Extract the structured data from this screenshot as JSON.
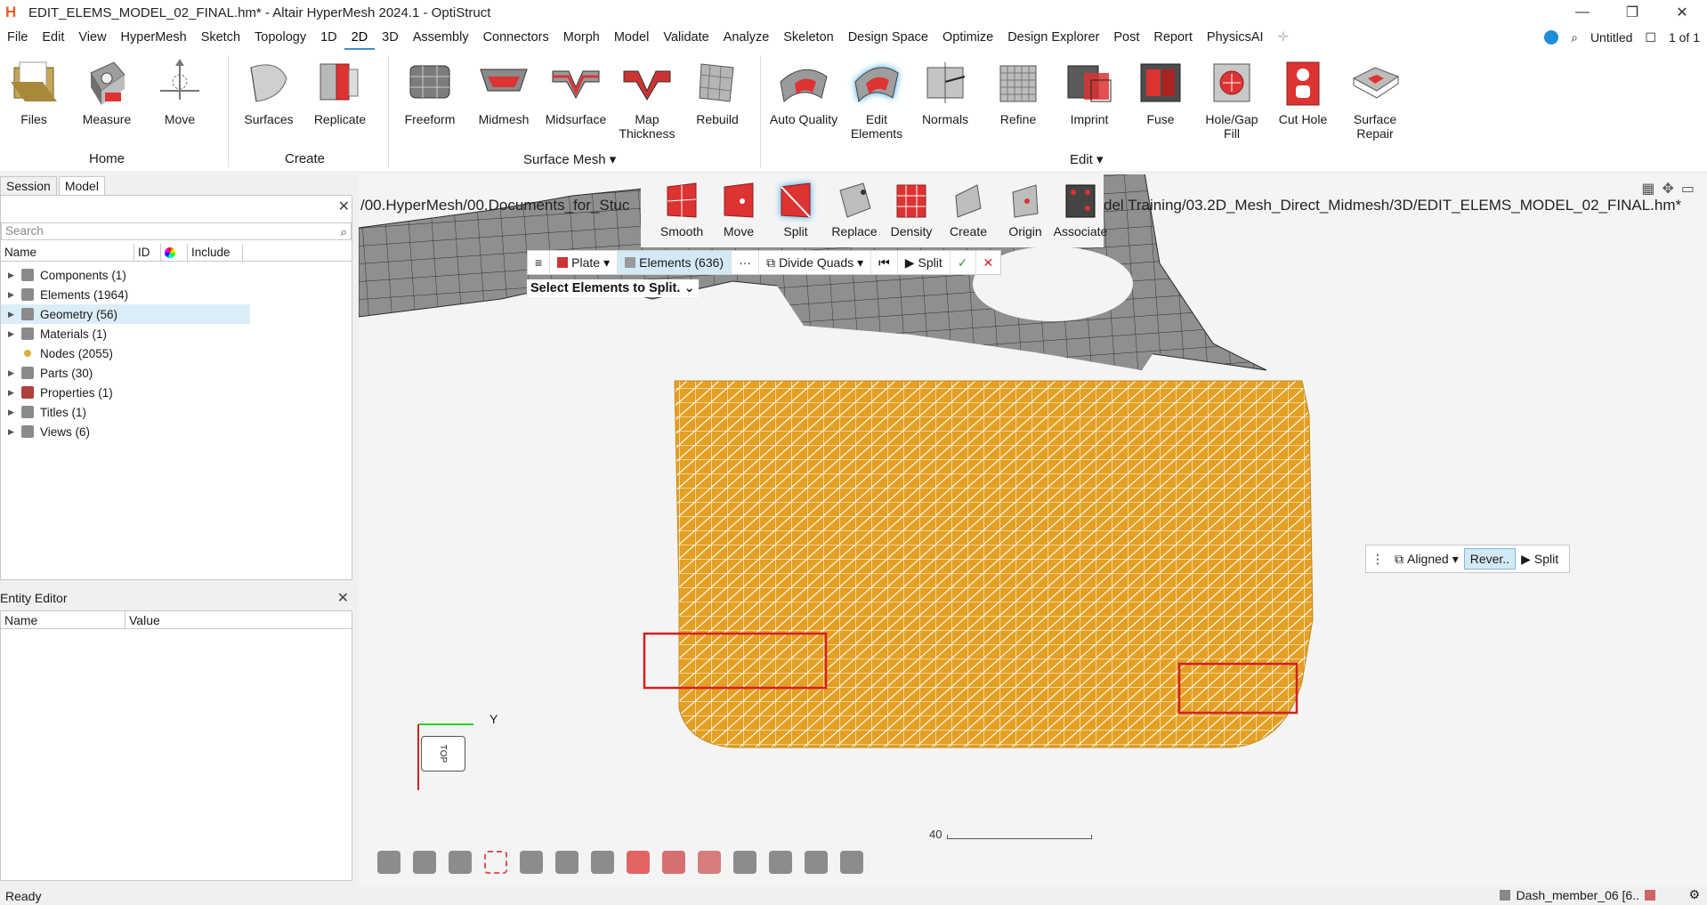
{
  "window": {
    "title": "EDIT_ELEMS_MODEL_02_FINAL.hm* - Altair HyperMesh 2024.1 - OptiStruct",
    "minimize": "—",
    "restore": "❐",
    "close": "✕"
  },
  "menu": {
    "items": [
      "File",
      "Edit",
      "View",
      "HyperMesh",
      "Sketch",
      "Topology",
      "1D",
      "2D",
      "3D",
      "Assembly",
      "Connectors",
      "Morph",
      "Model",
      "Validate",
      "Analyze",
      "Skeleton",
      "Design Space",
      "Optimize",
      "Design Explorer",
      "Post",
      "Report",
      "PhysicsAI"
    ],
    "active": "2D",
    "session_name": "Untitled",
    "page": "1 of 1"
  },
  "ribbon": {
    "home": {
      "label": "Home",
      "tools": [
        "Files",
        "Measure",
        "Move"
      ]
    },
    "create": {
      "label": "Create",
      "tools": [
        "Surfaces",
        "Replicate"
      ]
    },
    "surface_mesh": {
      "label": "Surface Mesh",
      "tools": [
        "Freeform",
        "Midmesh",
        "Midsurface",
        "Map\nThickness",
        "Rebuild"
      ]
    },
    "edit": {
      "label": "Edit",
      "tools": [
        "Auto Quality",
        "Edit\nElements",
        "Normals",
        "Refine",
        "Imprint",
        "Fuse",
        "Hole/Gap Fill",
        "Cut Hole",
        "Surface\nRepair"
      ]
    }
  },
  "left_panel": {
    "tabs": [
      "Session",
      "Model"
    ],
    "active_tab": "Model",
    "search_placeholder": "Search",
    "columns": [
      "Name",
      "ID",
      "",
      "Include"
    ],
    "tree": [
      {
        "label": "Components",
        "count": "(1)"
      },
      {
        "label": "Elements",
        "count": "(1964)"
      },
      {
        "label": "Geometry",
        "count": "(56)",
        "selected": true
      },
      {
        "label": "Materials",
        "count": "(1)"
      },
      {
        "label": "Nodes",
        "count": "(2055)"
      },
      {
        "label": "Parts",
        "count": "(30)"
      },
      {
        "label": "Properties",
        "count": "(1)"
      },
      {
        "label": "Titles",
        "count": "(1)"
      },
      {
        "label": "Views",
        "count": "(6)"
      }
    ]
  },
  "entity_editor": {
    "title": "Entity Editor",
    "columns": [
      "Name",
      "Value"
    ]
  },
  "viewport": {
    "path": "/00.HyperMesh/00.Documents_for_Stuc",
    "path_right": "del Training/03.2D_Mesh_Direct_Midmesh/3D/EDIT_ELEMS_MODEL_02_FINAL.hm*",
    "subtools": [
      "Smooth",
      "Move",
      "Split",
      "Replace",
      "Density",
      "Create",
      "Origin",
      "Associate"
    ],
    "active_subtool": "Split",
    "guide_bar": {
      "type": "Plate",
      "selection": "Elements (636)",
      "more": "···",
      "mode": "Divide Quads",
      "apply": "Split"
    },
    "prompt": "Select Elements to Split.",
    "micro_bar": {
      "option1": "Aligned",
      "option2": "Rever..",
      "apply": "Split"
    },
    "scale_value": "40",
    "axis_label": "Y",
    "cube_face": "TOP"
  },
  "status": {
    "left": "Ready",
    "component": "Dash_member_06 [6.."
  },
  "colors": {
    "mesh_gray": "#8f8f8f",
    "mesh_orange": "#e3a024",
    "highlight_red": "#d42020",
    "accent_blue": "#3b8ed0"
  }
}
